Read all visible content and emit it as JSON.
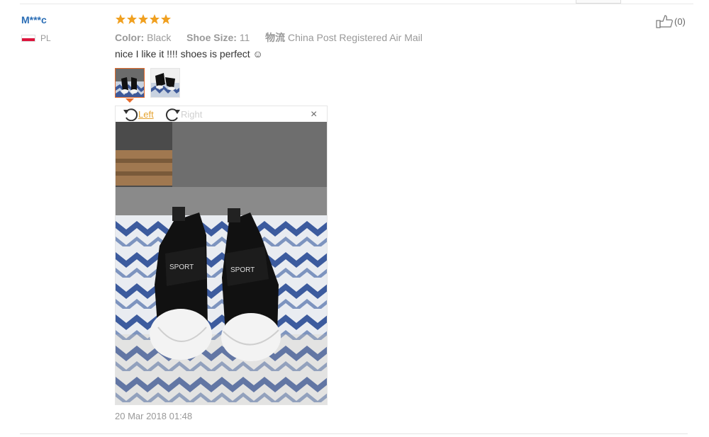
{
  "review": {
    "user": {
      "name": "M***c",
      "country_code": "PL"
    },
    "rating": {
      "stars": 5,
      "max": 5
    },
    "specs": {
      "color_label": "Color:",
      "color_value": "Black",
      "size_label": "Shoe Size:",
      "size_value": "11",
      "shipping_label": "物流",
      "shipping_value": "China Post Registered Air Mail"
    },
    "text": "nice I like it !!!! shoes is perfect ☺",
    "date": "20 Mar 2018 01:48",
    "helpful": {
      "count_text": "(0)"
    },
    "photos": {
      "count": 2,
      "selected_index": 0
    },
    "viewer": {
      "rotate_left_label": "Left",
      "rotate_right_label": "Right",
      "close_symbol": "×"
    },
    "photo_labels": {
      "left_shoe": "SPORT",
      "right_shoe": "SPORT"
    },
    "icons": [
      "star-icon",
      "thumbs-up-icon",
      "rotate-left-icon",
      "rotate-right-icon",
      "close-icon",
      "flag-icon"
    ],
    "colors": {
      "accent": "#e56b2b",
      "star": "#f0a020",
      "username": "#2a6db5",
      "rotate_active": "#e5a433"
    }
  }
}
